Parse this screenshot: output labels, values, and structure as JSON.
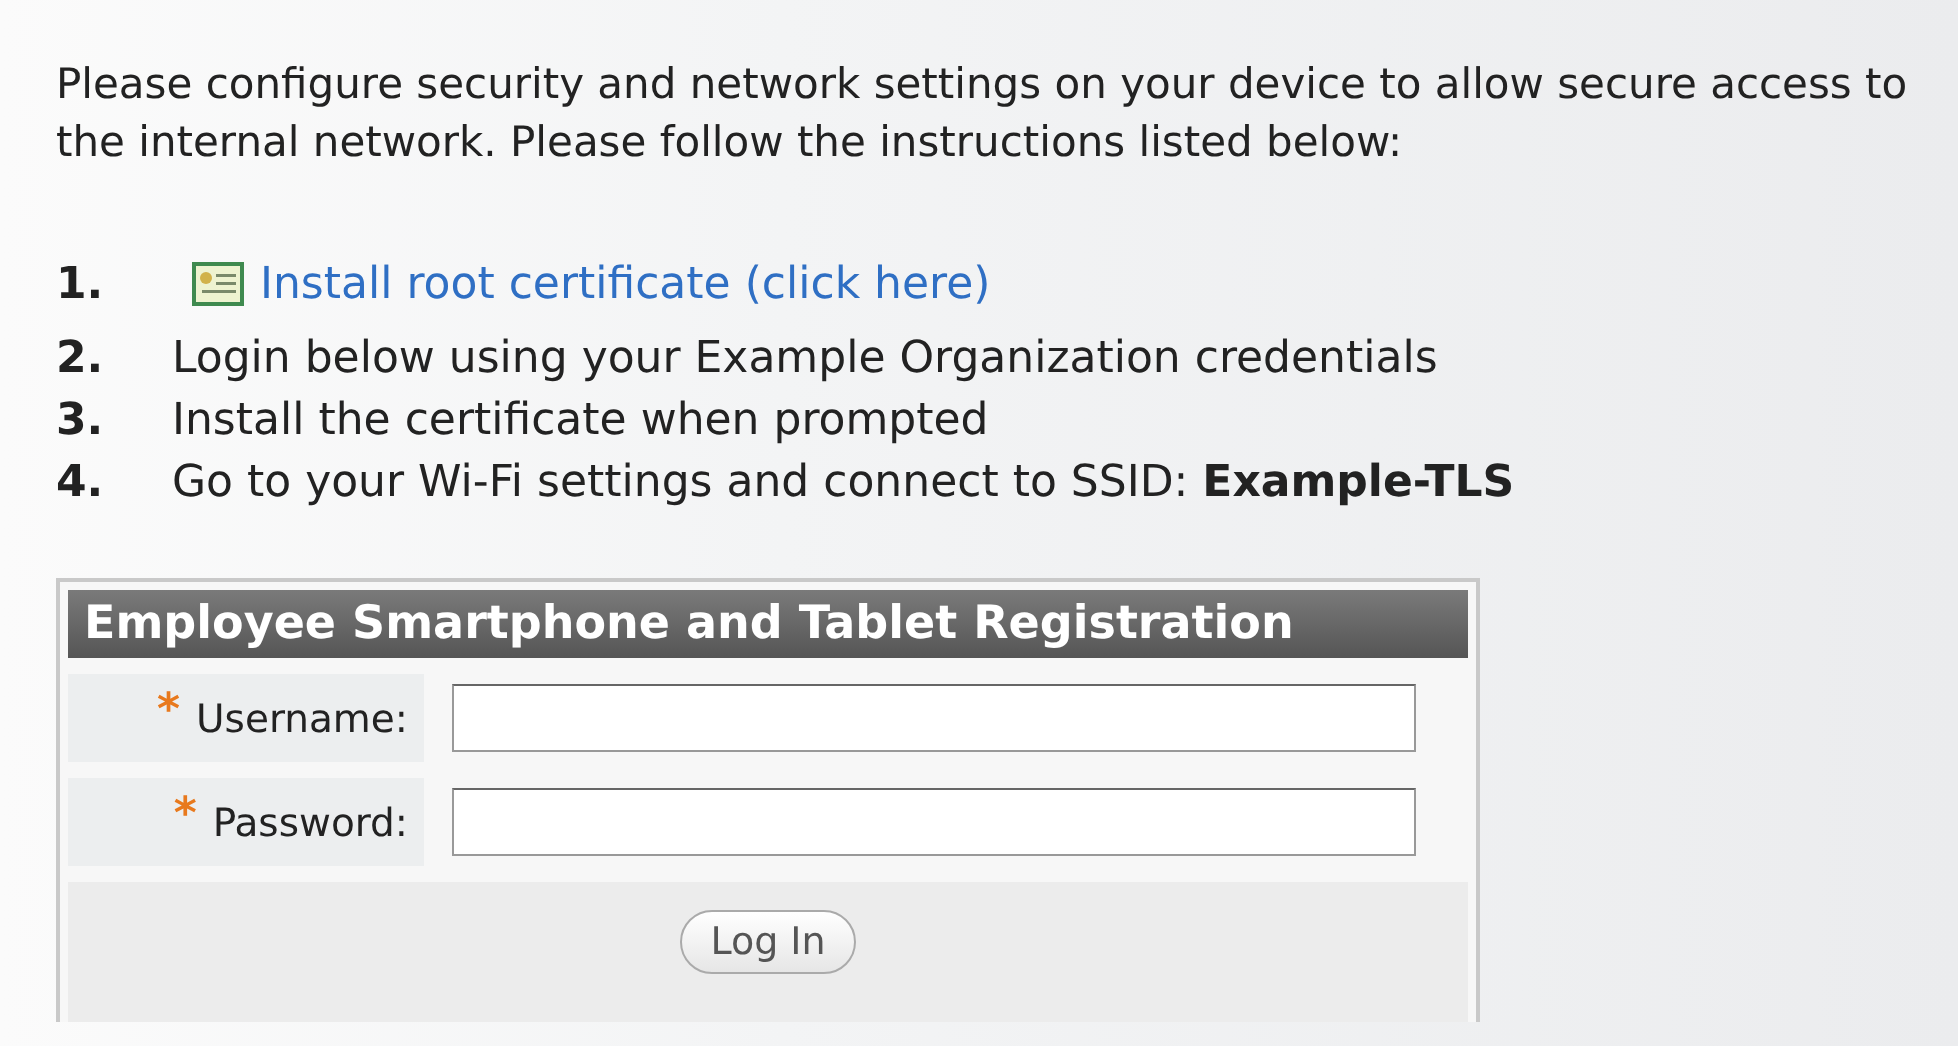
{
  "intro": "Please configure security and network settings on your device to allow secure access to the internal network. Please follow the instructions listed below:",
  "steps": [
    {
      "number": "1.",
      "kind": "link",
      "text": "Install root certificate (click here)"
    },
    {
      "number": "2.",
      "kind": "text",
      "text": "Login below using your Example Organization credentials"
    },
    {
      "number": "3.",
      "kind": "text",
      "text": "Install the certificate when prompted"
    },
    {
      "number": "4.",
      "kind": "text",
      "text": "Go to your Wi-Fi settings and connect to SSID: **Example-TLS**"
    }
  ],
  "form": {
    "title": "Employee Smartphone and Tablet Registration",
    "fields": [
      {
        "required_mark": "*",
        "label": "Username:"
      },
      {
        "required_mark": "*",
        "label": "Password:"
      }
    ],
    "button": "Log In"
  }
}
